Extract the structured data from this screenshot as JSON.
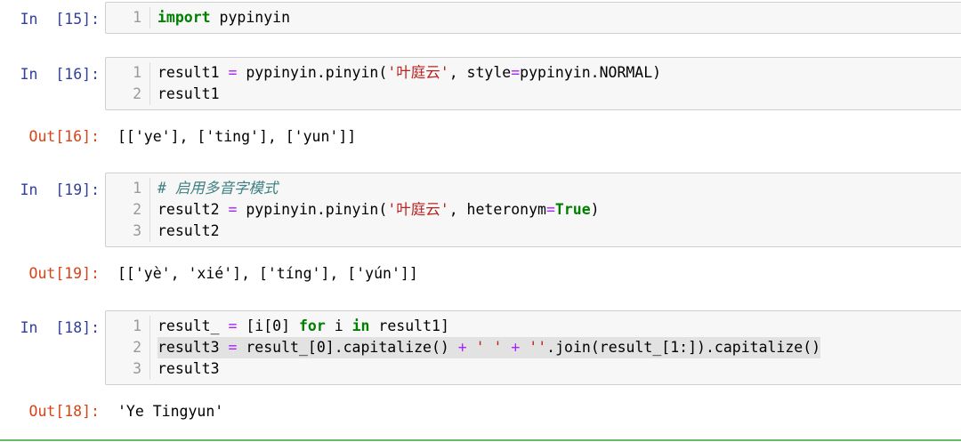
{
  "colors": {
    "prompt_in": "#303f9f",
    "prompt_out": "#d84315",
    "keyword": "#008000",
    "operator": "#aa22ff",
    "string": "#ba2121",
    "comment": "#408080",
    "selected_cell_border": "#66bb6a"
  },
  "cells": [
    {
      "in_prompt": "In  [15]:",
      "lines": [
        {
          "n": "1",
          "tokens": [
            {
              "t": "import",
              "c": "kw"
            },
            {
              "t": " pypinyin"
            }
          ]
        }
      ]
    },
    {
      "in_prompt": "In  [16]:",
      "lines": [
        {
          "n": "1",
          "tokens": [
            {
              "t": "result1 "
            },
            {
              "t": "=",
              "c": "op"
            },
            {
              "t": " pypinyin.pinyin("
            },
            {
              "t": "'叶庭云'",
              "c": "str"
            },
            {
              "t": ", style"
            },
            {
              "t": "=",
              "c": "op"
            },
            {
              "t": "pypinyin.NORMAL)"
            }
          ]
        },
        {
          "n": "2",
          "tokens": [
            {
              "t": "result1"
            }
          ]
        }
      ],
      "out_prompt": "Out[16]:",
      "output": "[['ye'], ['ting'], ['yun']]"
    },
    {
      "in_prompt": "In  [19]:",
      "lines": [
        {
          "n": "1",
          "tokens": [
            {
              "t": "# 启用多音字模式",
              "c": "cm"
            }
          ]
        },
        {
          "n": "2",
          "tokens": [
            {
              "t": "result2 "
            },
            {
              "t": "=",
              "c": "op"
            },
            {
              "t": " pypinyin.pinyin("
            },
            {
              "t": "'叶庭云'",
              "c": "str"
            },
            {
              "t": ", heteronym"
            },
            {
              "t": "=",
              "c": "op"
            },
            {
              "t": "True",
              "c": "kw"
            },
            {
              "t": ")"
            }
          ]
        },
        {
          "n": "3",
          "tokens": [
            {
              "t": "result2"
            }
          ]
        }
      ],
      "out_prompt": "Out[19]:",
      "output": "[['yè', 'xié'], ['tíng'], ['yún']]"
    },
    {
      "in_prompt": "In  [18]:",
      "lines": [
        {
          "n": "1",
          "tokens": [
            {
              "t": "result_ "
            },
            {
              "t": "=",
              "c": "op"
            },
            {
              "t": " [i[0] "
            },
            {
              "t": "for",
              "c": "kw"
            },
            {
              "t": " i "
            },
            {
              "t": "in",
              "c": "kw"
            },
            {
              "t": " result1]"
            }
          ]
        },
        {
          "n": "2",
          "highlight": true,
          "tokens": [
            {
              "t": "result3 "
            },
            {
              "t": "=",
              "c": "op"
            },
            {
              "t": " result_[0].capitalize() "
            },
            {
              "t": "+",
              "c": "op"
            },
            {
              "t": " "
            },
            {
              "t": "' '",
              "c": "str"
            },
            {
              "t": " "
            },
            {
              "t": "+",
              "c": "op"
            },
            {
              "t": " "
            },
            {
              "t": "''",
              "c": "str"
            },
            {
              "t": ".join(result_[1:]).capitalize()"
            }
          ]
        },
        {
          "n": "3",
          "tokens": [
            {
              "t": "result3"
            }
          ]
        }
      ],
      "out_prompt": "Out[18]:",
      "output": "'Ye Tingyun'"
    }
  ]
}
